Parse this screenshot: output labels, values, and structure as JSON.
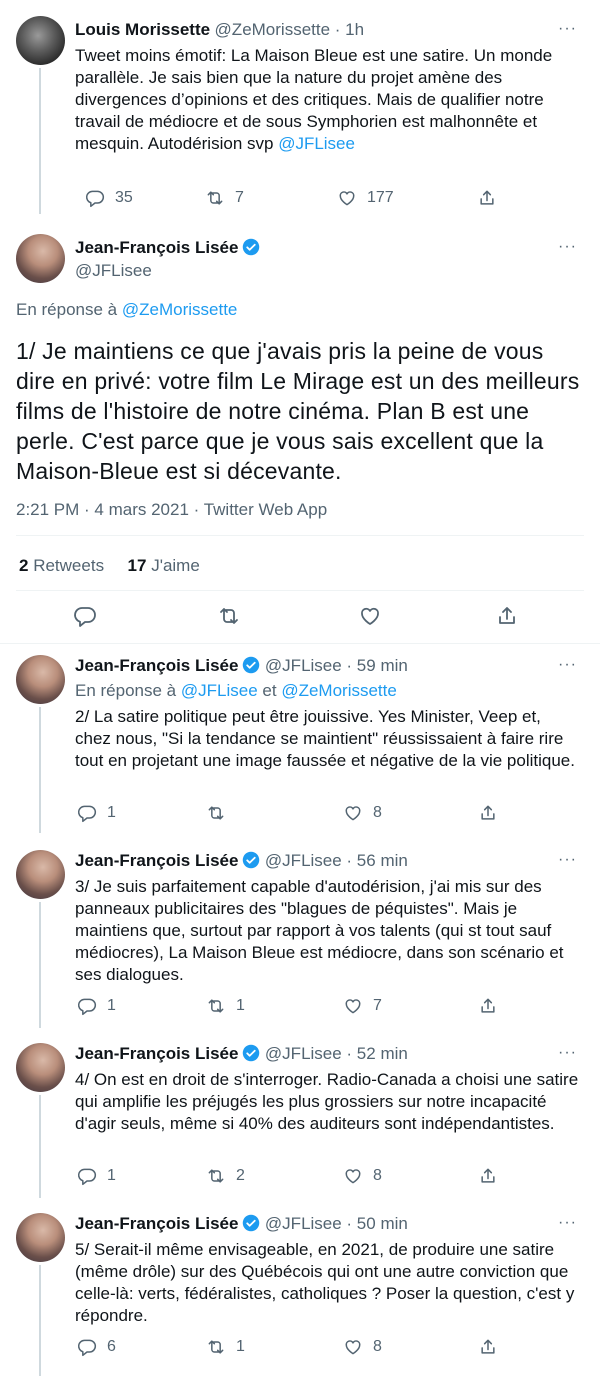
{
  "tweets": [
    {
      "name": "Louis Morissette",
      "handle": "@ZeMorissette · 1h",
      "text_plain": "Tweet moins émotif: La Maison Bleue est une satire.  Un monde parallèle. Je sais bien que la nature du projet amène des divergences d’opinions et des critiques. Mais de qualifier notre travail de médiocre et de sous Symphorien est malhonnête et mesquin. Autodérision svp",
      "text_mention": "@JFLisee",
      "replies": "35",
      "retweets": "7",
      "likes": "177"
    }
  ],
  "main": {
    "name": "Jean-François Lisée",
    "handle": "@JFLisee",
    "reply_prefix": "En réponse à",
    "reply_to": "@ZeMorissette",
    "text": "1/ Je maintiens ce que j'avais pris la peine de vous dire en privé: votre film Le Mirage est un des meilleurs films de l'histoire de notre cinéma. Plan B est une perle. C'est parce que je vous sais excellent que la Maison-Bleue est si décevante.",
    "timestamp": "2:21 PM · 4 mars 2021 · Twitter Web App",
    "retweets_count": "2",
    "retweets_label": "Retweets",
    "likes_count": "17",
    "likes_label": "J'aime"
  },
  "replies": [
    {
      "name": "Jean-François Lisée",
      "handle": "@JFLisee · 59 min",
      "reply_prefix": "En réponse à",
      "reply_to_1": "@JFLisee",
      "reply_and": "et",
      "reply_to_2": "@ZeMorissette",
      "text": "2/ La satire politique peut être jouissive. Yes Minister, Veep et, chez nous, \"Si la tendance se maintient\" réussissaient à faire rire tout en projetant une image faussée et négative de la vie politique.",
      "replies": "1",
      "retweets": "",
      "likes": "8"
    },
    {
      "name": "Jean-François Lisée",
      "handle": "@JFLisee · 56 min",
      "text": "3/ Je suis parfaitement capable d'autodérision, j'ai mis sur des panneaux publicitaires des \"blagues de péquistes\". Mais je maintiens que, surtout par rapport à vos talents (qui st tout sauf médiocres), La Maison Bleue est médiocre, dans son scénario et ses dialogues.",
      "replies": "1",
      "retweets": "1",
      "likes": "7"
    },
    {
      "name": "Jean-François Lisée",
      "handle": "@JFLisee · 52 min",
      "text": "4/ On est en droit de s'interroger. Radio-Canada a choisi une satire qui amplifie les préjugés les plus grossiers sur notre incapacité d'agir seuls, même si 40% des auditeurs sont indépendantistes.",
      "replies": "1",
      "retweets": "2",
      "likes": "8"
    },
    {
      "name": "Jean-François Lisée",
      "handle": "@JFLisee · 50 min",
      "text": "5/ Serait-il même envisageable, en 2021, de produire une satire (même drôle) sur des Québécois qui ont une autre conviction que celle-là: verts, fédéralistes, catholiques ? Poser la question, c'est y répondre.",
      "replies": "6",
      "retweets": "1",
      "likes": "8"
    }
  ],
  "icons": {
    "more": "more-icon",
    "reply": "reply-icon",
    "retweet": "retweet-icon",
    "like": "like-icon",
    "share": "share-icon",
    "verified": "verified-badge-icon"
  },
  "colors": {
    "accent": "#1d9bf0",
    "text": "#0f1419",
    "secondary": "#536471",
    "thread_line": "#cfd9de"
  },
  "more_glyph": "···"
}
